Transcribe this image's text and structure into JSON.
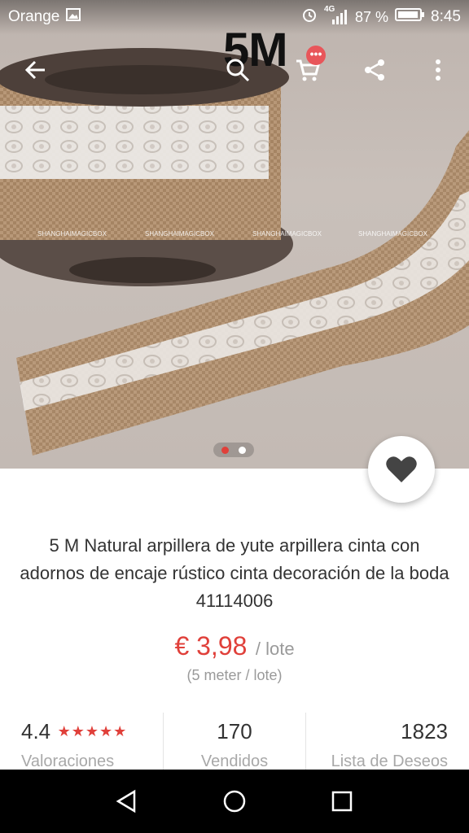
{
  "status_bar": {
    "carrier": "Orange",
    "network": "4G",
    "battery_percent": "87 %",
    "time": "8:45"
  },
  "image_overlay_text": "5M",
  "toolbar": {
    "icons": [
      "back-arrow-icon",
      "search-icon",
      "cart-icon",
      "share-icon",
      "more-vertical-icon"
    ],
    "cart_badge": "•••"
  },
  "gallery": {
    "image_count": 2,
    "active_index": 0
  },
  "watermark": [
    "SHANGHAIMAGICBOX",
    "SHANGHAIMAGICBOX",
    "SHANGHAIMAGICBOX",
    "SHANGHAIMAGICBOX"
  ],
  "product": {
    "title": "5 M Natural arpillera de yute arpillera cinta con adornos de encaje rústico cinta decoración de la boda 41114006",
    "price": "€ 3,98",
    "price_unit": "/ lote",
    "lot_size": "(5 meter / lote)"
  },
  "stats": {
    "rating": "4.4",
    "rating_stars": "★★★★★",
    "rating_label": "Valoraciones",
    "sold": "170",
    "sold_label": "Vendidos",
    "wishlist": "1823",
    "wishlist_label": "Lista de Deseos"
  },
  "colors": {
    "accent": "#e0403a",
    "muted": "#9a9a9a",
    "nav_bg": "#000000"
  }
}
